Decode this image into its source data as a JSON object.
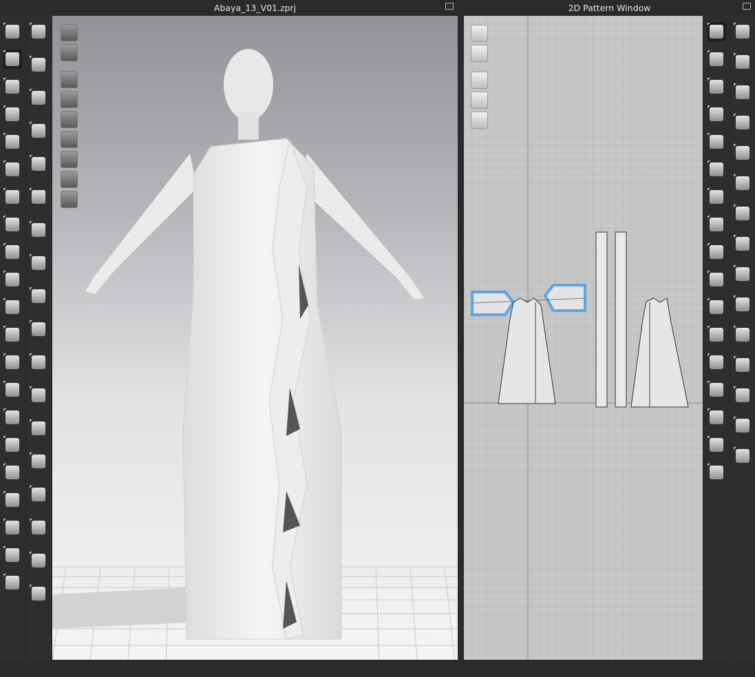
{
  "viewport3d": {
    "title": "Abaya_13_V01.zprj"
  },
  "pattern_window": {
    "title": "2D Pattern Window"
  },
  "colors": {
    "accent": "#3399dd",
    "selection_blue": "#5aa6e6",
    "background": "#2b2b2b"
  },
  "left_toolbar_col1_icons": [
    "move-down-icon",
    "transform-gizmo-icon",
    "select-mesh-icon",
    "garment-icon",
    "pin-icon",
    "pin-group-icon",
    "measure-icon",
    "tape-icon",
    "line-tool-icon",
    "camera-icon",
    "fold-icon",
    "avatar-measure-icon",
    "garment-fit-icon",
    "gift-icon",
    "hanger-icon",
    "body-icon",
    "stretch-icon",
    "ruler-icon",
    "tape-measure-icon",
    "shirt-fit-icon",
    "shirt-check-icon"
  ],
  "left_toolbar_col2_icons": [
    "walk-icon",
    "thin-brush-icon",
    "check-brush-icon",
    "check-brush-2-icon",
    "fold-brush-icon",
    "fold-x-icon",
    "puff-icon",
    "fabric-grid-icon",
    "buttonhole-icon",
    "button-icon",
    "lock-button-icon",
    "zipper-icon",
    "zipper-pull-icon",
    "topstitch-icon",
    "fabric-swatch-icon",
    "fabric-small-icon",
    "fabric-gradient-icon",
    "tack-icon"
  ],
  "viewport_icons": [
    "avatar-box-icon",
    "garment-preview-icon",
    "show-garment-icon",
    "show-pin-icon",
    "show-avatar-icon",
    "texture-icon",
    "print-icon",
    "avatar-silhouette-icon",
    "globe-icon"
  ],
  "pattern_view_icons": [
    "pen-visible-icon",
    "shirt-visible-icon",
    "info-visible-icon",
    "fabric-visible-icon",
    "lock-shirt-icon"
  ],
  "right_toolbar_col1_icons": [
    "transform-pattern-icon",
    "edit-point-icon",
    "add-point-icon",
    "rectangle-icon",
    "pattern-icon",
    "internal-rectangle-icon",
    "dart-icon",
    "cut-line-icon",
    "trace-icon",
    "symmetric-icon",
    "measure-pattern-icon",
    "ruler-pattern-icon",
    "text-a-icon",
    "text-big-a-icon",
    "grid-icon",
    "copy-pattern-icon",
    "avatar-small-icon"
  ],
  "right_toolbar_col2_icons": [
    "edit-sewing-icon",
    "segment-sewing-icon",
    "free-sewing-icon",
    "check-sewing-icon",
    "iron-icon",
    "fit-shirt-icon",
    "puff-pattern-icon",
    "gather-icon",
    "elastic-icon",
    "topstitch-line-icon",
    "dash-line-icon",
    "zigzag-icon",
    "wave-icon",
    "add-trim-icon",
    "gift-pattern-icon"
  ]
}
